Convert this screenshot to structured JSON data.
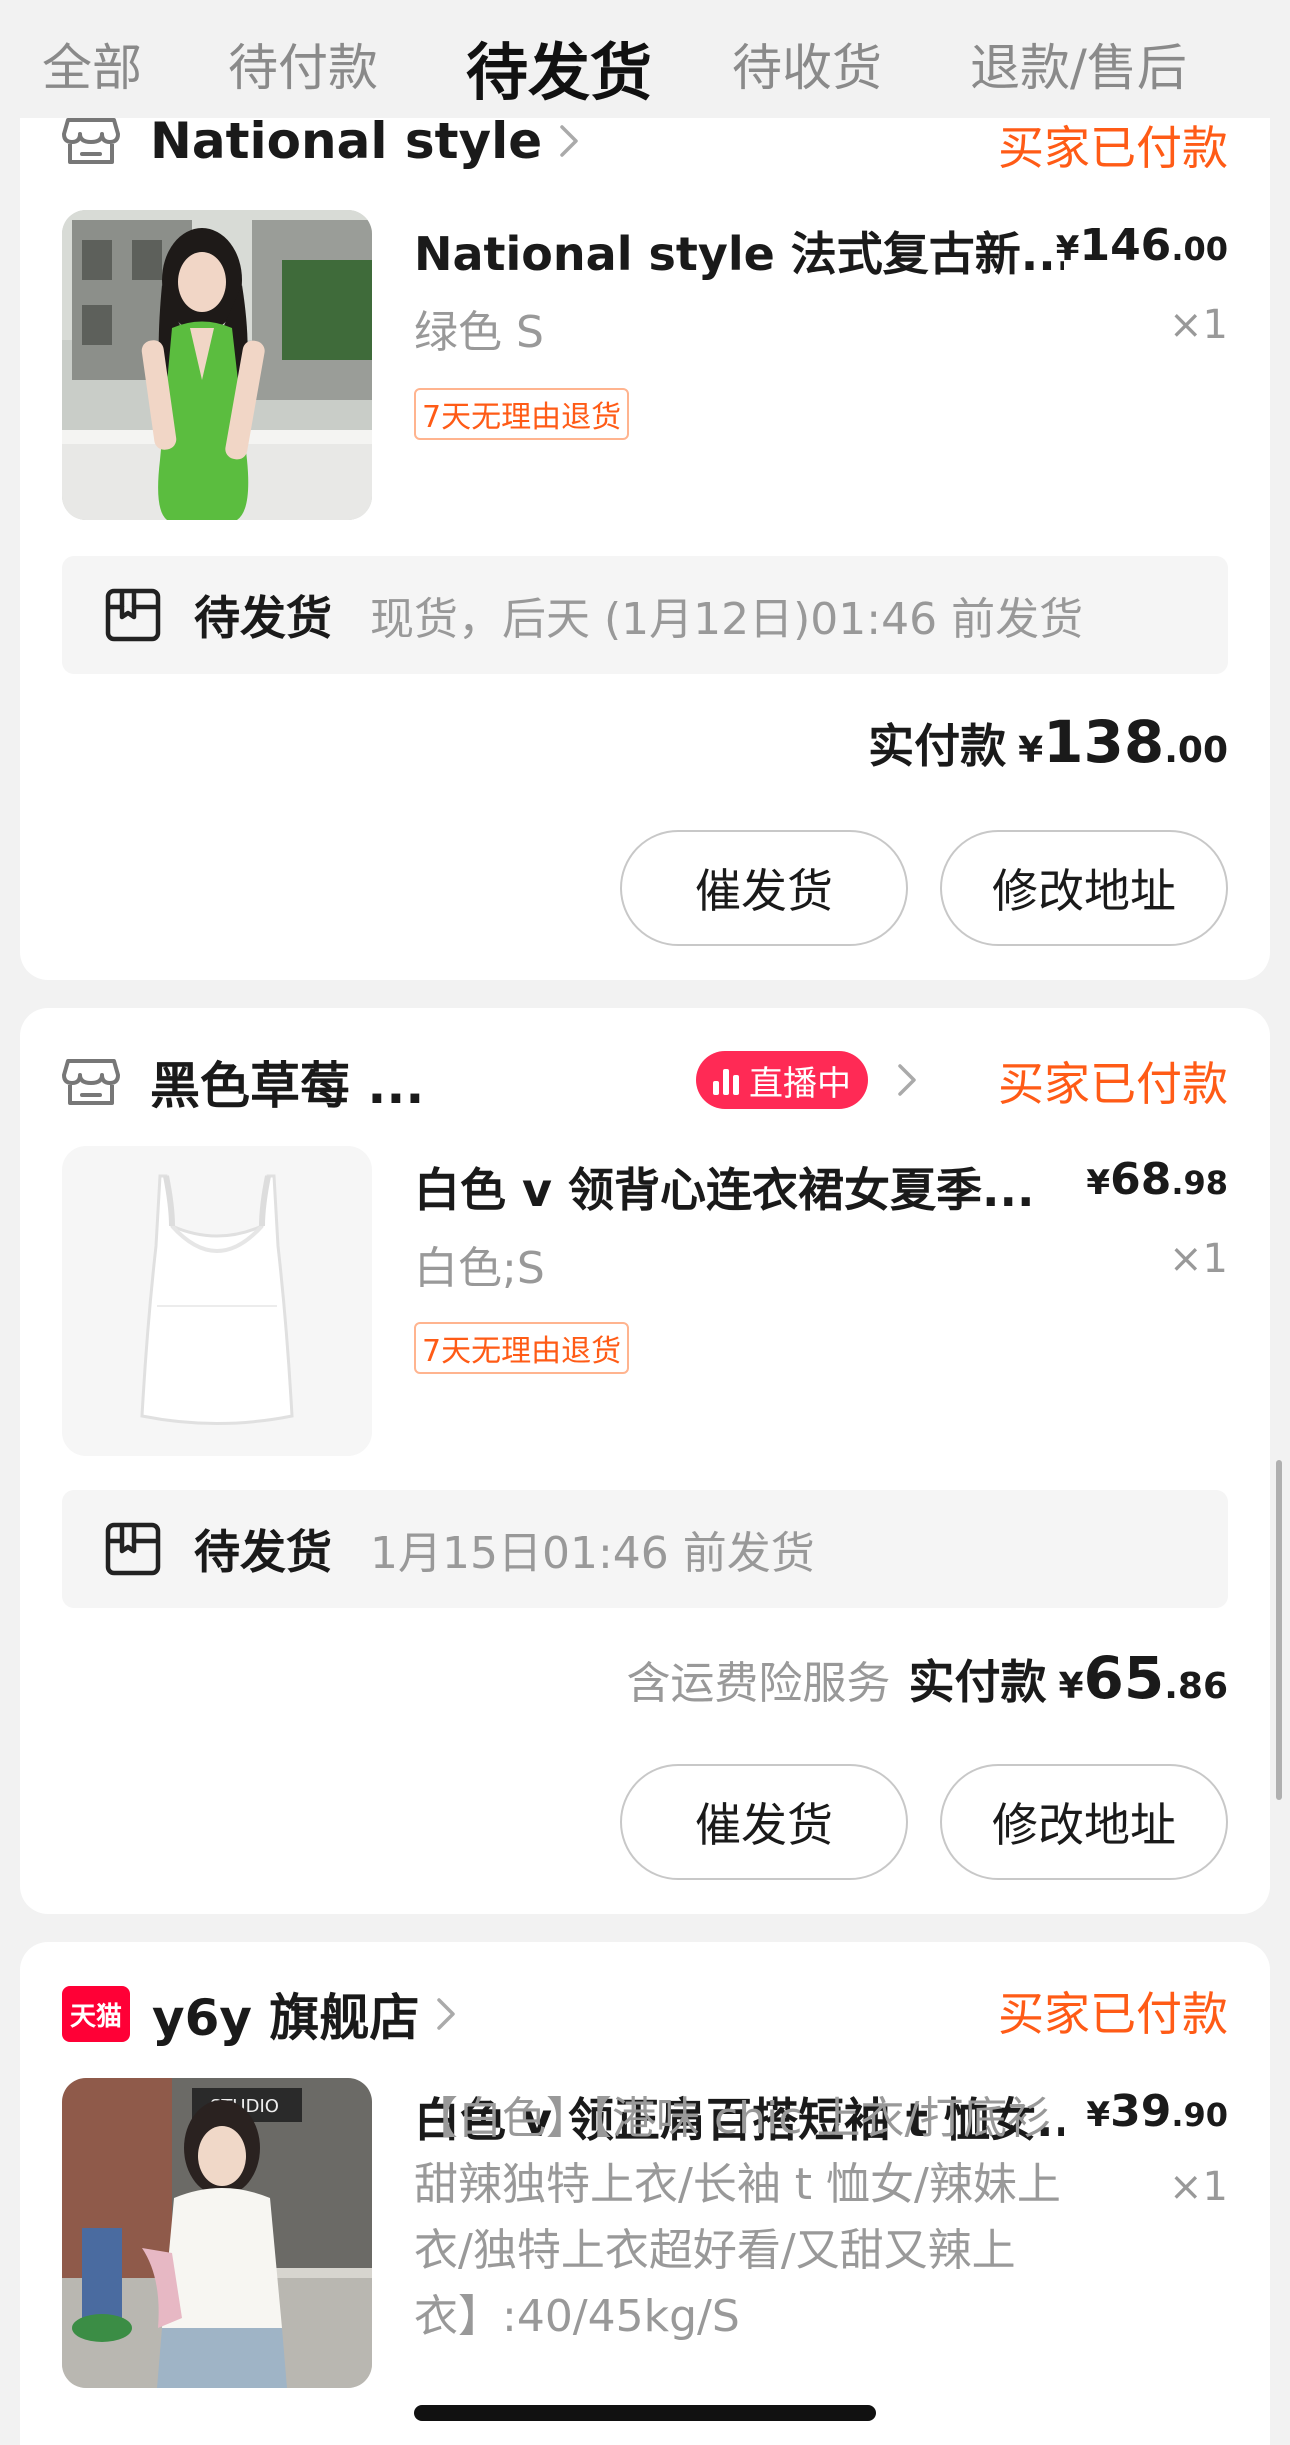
{
  "tabs": [
    {
      "label": "全部"
    },
    {
      "label": "待付款"
    },
    {
      "label": "待发货",
      "active": true
    },
    {
      "label": "待收货"
    },
    {
      "label": "退款/售后"
    }
  ],
  "orders": [
    {
      "store_name": "National style",
      "status": "买家已付款",
      "product_title": "National style 法式复古新...",
      "price": {
        "currency": "¥",
        "int": "146",
        "dec": ".00"
      },
      "variant": "绿色 S",
      "quantity": "×1",
      "badge": "7天无理由退货",
      "shipping_label": "待发货",
      "shipping_text": "现货，后天 (1月12日)01:46 前发货",
      "total_label": "实付款",
      "total": {
        "currency": "¥",
        "int": "138",
        "dec": ".00"
      },
      "buttons": {
        "urge": "催发货",
        "address": "修改地址"
      }
    },
    {
      "store_name": "黑色草莓 ...",
      "live_badge": "直播中",
      "status": "买家已付款",
      "product_title": "白色 v 领背心连衣裙女夏季...",
      "price": {
        "currency": "¥",
        "int": "68",
        "dec": ".98"
      },
      "variant": "白色;S",
      "quantity": "×1",
      "badge": "7天无理由退货",
      "shipping_label": "待发货",
      "shipping_text": "1月15日01:46 前发货",
      "total_note": "含运费险服务",
      "total_label": "实付款",
      "total": {
        "currency": "¥",
        "int": "65",
        "dec": ".86"
      },
      "buttons": {
        "urge": "催发货",
        "address": "修改地址"
      }
    },
    {
      "store_logo_text": "天猫",
      "store_name": "y6y 旗舰店",
      "status": "买家已付款",
      "product_title": "白色 v 领正肩百搭短袖 t 恤女...",
      "price": {
        "currency": "¥",
        "int": "39",
        "dec": ".90"
      },
      "variant": "【白色】【港味 chic 上衣/打底衫甜辣独特上衣/长袖 t 恤女/辣妹上衣/独特上衣超好看/又甜又辣上衣】:40/45kg/S",
      "quantity": "×1"
    }
  ],
  "thumb_image_text": "STUDIO",
  "colors": {
    "accent": "#ff5b16",
    "live": "#ff2a55",
    "tmall": "#ff0036"
  },
  "icons": [
    "store-icon",
    "chevron-right-icon",
    "package-icon",
    "live-bars-icon",
    "tmall-logo-icon"
  ]
}
